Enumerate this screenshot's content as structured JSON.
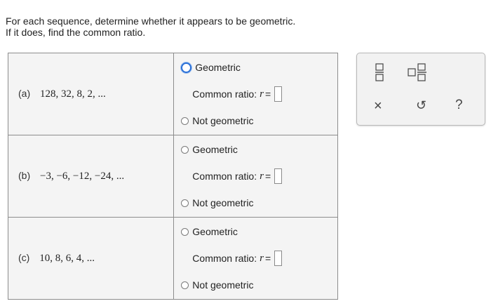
{
  "instructions": {
    "line1": "For each sequence, determine whether it appears to be geometric.",
    "line2": "If it does, find the common ratio."
  },
  "options": {
    "geometric": "Geometric",
    "not_geometric": "Not geometric",
    "common_ratio_label": "Common ratio:",
    "ratio_variable": "r",
    "equals": "="
  },
  "parts": [
    {
      "label": "(a)",
      "sequence": "128, 32, 8, 2, ...",
      "selected": "Geometric"
    },
    {
      "label": "(b)",
      "sequence": "−3, −6, −12, −24, ...",
      "selected": ""
    },
    {
      "label": "(c)",
      "sequence": "10, 8, 6, 4, ...",
      "selected": ""
    }
  ],
  "toolbox": {
    "clear_label": "×",
    "undo_label": "↺",
    "help_label": "?",
    "icons": [
      "fraction-icon",
      "mixed-number-icon",
      "clear-icon",
      "undo-icon",
      "help-icon"
    ]
  },
  "colors": {
    "selected_radio": "#2a6fd6",
    "table_bg": "#f4f4f4",
    "border": "#8c8c8c"
  }
}
